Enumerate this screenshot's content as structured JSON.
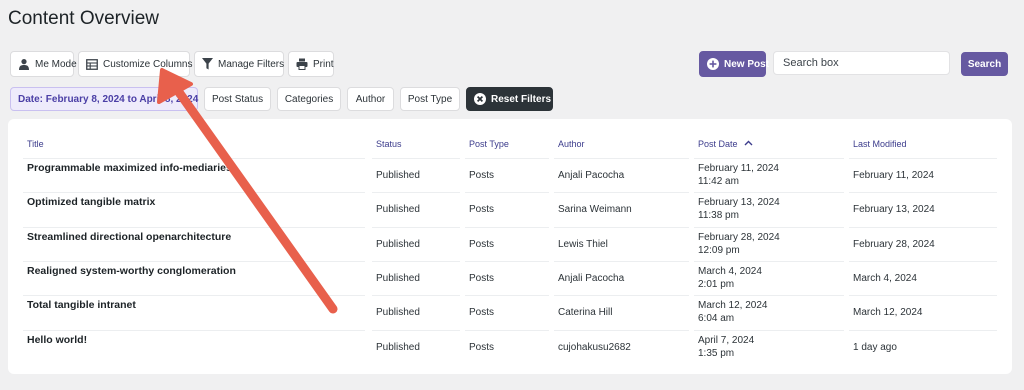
{
  "page": {
    "title": "Content Overview"
  },
  "toolbar": {
    "me_mode": "Me Mode",
    "customize_columns": "Customize Columns",
    "manage_filters": "Manage Filters",
    "print": "Print",
    "new_post": "New Post",
    "search_placeholder": "Search box",
    "search": "Search"
  },
  "filters": {
    "date_range": "Date: February 8, 2024 to April 8, 2024",
    "post_status": "Post Status",
    "categories": "Categories",
    "author": "Author",
    "post_type": "Post Type",
    "reset": "Reset Filters"
  },
  "table": {
    "headers": {
      "title": "Title",
      "status": "Status",
      "post_type": "Post Type",
      "author": "Author",
      "post_date": "Post Date",
      "last_modified": "Last Modified"
    },
    "sort": {
      "column": "post_date",
      "direction": "ascending",
      "icon": "chevron-up-icon"
    },
    "rows": [
      {
        "title": "Programmable maximized info-mediaries",
        "status": "Published",
        "post_type": "Posts",
        "author": "Anjali Pacocha",
        "date": "February 11, 2024",
        "time": "11:42 am",
        "modified": "February 11, 2024"
      },
      {
        "title": "Optimized tangible matrix",
        "status": "Published",
        "post_type": "Posts",
        "author": "Sarina Weimann",
        "date": "February 13, 2024",
        "time": "11:38 pm",
        "modified": "February 13, 2024"
      },
      {
        "title": "Streamlined directional openarchitecture",
        "status": "Published",
        "post_type": "Posts",
        "author": "Lewis Thiel",
        "date": "February 28, 2024",
        "time": "12:09 pm",
        "modified": "February 28, 2024"
      },
      {
        "title": "Realigned system-worthy conglomeration",
        "status": "Published",
        "post_type": "Posts",
        "author": "Anjali Pacocha",
        "date": "March 4, 2024",
        "time": "2:01 pm",
        "modified": "March 4, 2024"
      },
      {
        "title": "Total tangible intranet",
        "status": "Published",
        "post_type": "Posts",
        "author": "Caterina Hill",
        "date": "March 12, 2024",
        "time": "6:04 am",
        "modified": "March 12, 2024"
      },
      {
        "title": "Hello world!",
        "status": "Published",
        "post_type": "Posts",
        "author": "cujohakusu2682",
        "date": "April 7, 2024",
        "time": "1:35 pm",
        "modified": "1 day ago"
      }
    ]
  },
  "annotation": {
    "icon": "pointer-arrow-icon",
    "color": "#e8604c"
  },
  "colors": {
    "accent": "#6659a1",
    "dark_button": "#2c3338",
    "date_chip_bg": "#eeebfb",
    "header_text": "#3c3c8c"
  }
}
